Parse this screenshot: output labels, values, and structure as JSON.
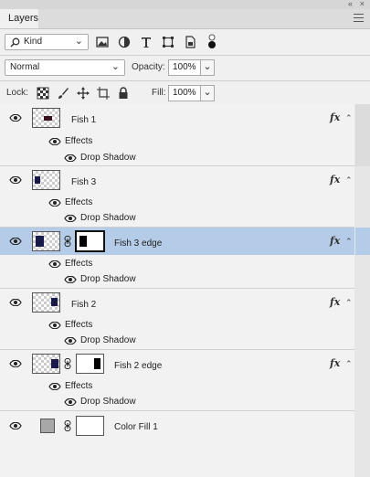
{
  "panel": {
    "tab_label": "Layers",
    "collapse_glyph": "«",
    "close_glyph": "×"
  },
  "filter": {
    "kind_label": "Kind",
    "icons": [
      "search-icon",
      "image-icon",
      "adjustment-icon",
      "type-icon",
      "shape-icon",
      "smart-object-icon",
      "filter-toggle-icon"
    ]
  },
  "blend": {
    "mode": "Normal",
    "opacity_label": "Opacity:",
    "opacity_value": "100%"
  },
  "lock": {
    "label": "Lock:",
    "icons": [
      "lock-transparent-icon",
      "lock-paint-icon",
      "lock-position-icon",
      "lock-artboard-icon",
      "lock-all-icon"
    ],
    "fill_label": "Fill:",
    "fill_value": "100%"
  },
  "layers": [
    {
      "name": "Fish 1",
      "selected": false,
      "has_mask": false,
      "fx": true,
      "effects_label": "Effects",
      "effect": "Drop Shadow"
    },
    {
      "name": "Fish 3",
      "selected": false,
      "has_mask": false,
      "fx": true,
      "effects_label": "Effects",
      "effect": "Drop Shadow"
    },
    {
      "name": "Fish 3 edge",
      "selected": true,
      "has_mask": true,
      "fx": true,
      "effects_label": "Effects",
      "effect": "Drop Shadow"
    },
    {
      "name": "Fish 2",
      "selected": false,
      "has_mask": false,
      "fx": true,
      "effects_label": "Effects",
      "effect": "Drop Shadow"
    },
    {
      "name": "Fish 2 edge",
      "selected": false,
      "has_mask": true,
      "fx": true,
      "effects_label": "Effects",
      "effect": "Drop Shadow"
    },
    {
      "name": "Color Fill 1",
      "selected": false,
      "has_mask": true,
      "fx": false
    }
  ],
  "fx_glyph": "fx",
  "colors": {
    "selected_row": "#b5cce8",
    "panel_bg": "#f0f0f0",
    "color_fill_swatch": "#a8a8a8"
  }
}
